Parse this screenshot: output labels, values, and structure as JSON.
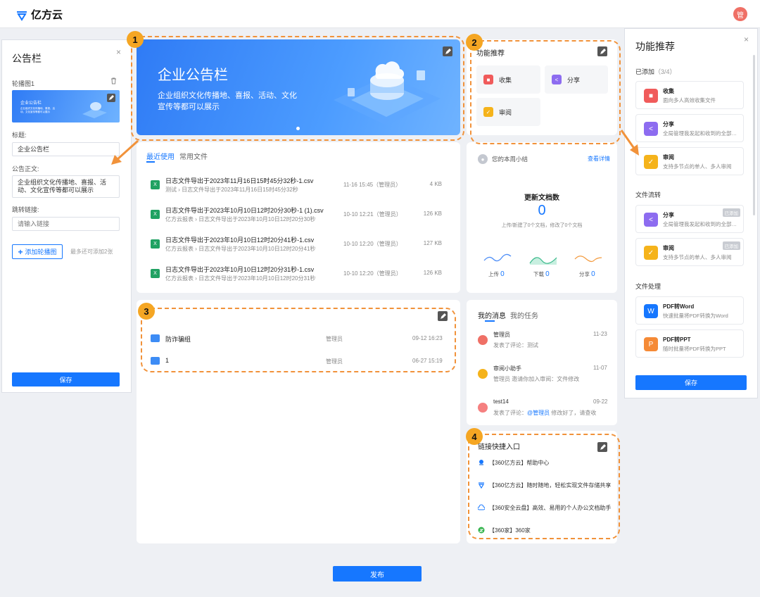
{
  "header": {
    "logo_text": "亿方云",
    "avatar_initial": "管"
  },
  "left_panel": {
    "title": "公告栏",
    "carousel_label": "轮播图1",
    "thumb_title": "企业公告栏",
    "thumb_desc": "企业组织文化传播地、喜报、活动、文化宣传等都可以展示",
    "title_label": "标题:",
    "title_value": "企业公告栏",
    "body_label": "公告正文:",
    "body_value": "企业组织文化传播地、喜报、活动、文化宣传等都可以展示",
    "link_label": "跳转链接:",
    "link_placeholder": "请输入链接",
    "add_button": "添加轮播图",
    "hint": "最多还可添加2张",
    "save": "保存"
  },
  "banner": {
    "title": "企业公告栏",
    "desc": "企业组织文化传播地、喜报、活动、文化宣传等都可以展示"
  },
  "badges": [
    "1",
    "2",
    "3",
    "4"
  ],
  "recent": {
    "tabs": [
      "最近使用",
      "常用文件"
    ],
    "files": [
      {
        "name": "日志文件导出于2023年11月16日15时45分32秒-1.csv",
        "owner": "测试",
        "path": "日志文件导出于2023年11月16日15时45分32秒",
        "time": "11-16 15:45（管理员）",
        "size": "4 KB"
      },
      {
        "name": "日志文件导出于2023年10月10日12时20分30秒-1 (1).csv",
        "owner": "亿方云报表",
        "path": "日志文件导出于2023年10月10日12时20分30秒",
        "time": "10-10 12:21（管理员）",
        "size": "126 KB"
      },
      {
        "name": "日志文件导出于2023年10月10日12时20分41秒-1.csv",
        "owner": "亿方云报表",
        "path": "日志文件导出于2023年10月10日12时20分41秒",
        "time": "10-10 12:20（管理员）",
        "size": "127 KB"
      },
      {
        "name": "日志文件导出于2023年10月10日12时20分31秒-1.csv",
        "owner": "亿方云报表",
        "path": "日志文件导出于2023年10月10日12时20分31秒",
        "time": "10-10 12:20（管理员）",
        "size": "126 KB"
      }
    ]
  },
  "folders": [
    {
      "name": "防诈骗组",
      "owner": "管理员",
      "time": "09-12 16:23"
    },
    {
      "name": "1",
      "owner": "管理员",
      "time": "06-27 15:19"
    }
  ],
  "func_card": {
    "title": "功能推荐",
    "items": [
      "收集",
      "分享",
      "审阅"
    ],
    "colors": [
      "#f05b5b",
      "#8d6cf0",
      "#f5b31b"
    ]
  },
  "weekly": {
    "title": "您的本周小结",
    "link": "查看详情",
    "stat_title": "更新文档数",
    "stat_value": "0",
    "stat_desc": "上传/新建了0个文档，修改了0个文档",
    "metrics": [
      {
        "label": "上传",
        "value": "0"
      },
      {
        "label": "下载",
        "value": "0"
      },
      {
        "label": "分享",
        "value": "0"
      }
    ]
  },
  "messages": {
    "tabs": [
      "我的消息",
      "我的任务"
    ],
    "items": [
      {
        "name": "管理员",
        "date": "11-23",
        "text": "发表了评论：测试",
        "mention": "",
        "tail": "",
        "color": "#ef7066"
      },
      {
        "name": "审阅小助手",
        "date": "11-07",
        "text": "管理员 邀请你加入审阅：文件修改",
        "mention": "",
        "tail": "",
        "color": "#f5b31b"
      },
      {
        "name": "test14",
        "date": "09-22",
        "text": "发表了评论：",
        "mention": "@管理员",
        "tail": " 修改好了，请查收",
        "color": "#f58080"
      }
    ]
  },
  "links": {
    "title": "链接快捷入口",
    "items": [
      "【360亿方云】帮助中心",
      "【360亿方云】随时随地，轻松实现文件存储共享",
      "【360安全云盘】高效、易用的个人办公文档助手",
      "【360家】360家"
    ]
  },
  "right_panel": {
    "title": "功能推荐",
    "added_label": "已添加",
    "added_count": "（3/4）",
    "added": [
      {
        "name": "收集",
        "desc": "面向多人高效收集文件",
        "color": "#f05b5b"
      },
      {
        "name": "分享",
        "desc": "全局管理我发起和收到的全部分享",
        "color": "#8d6cf0"
      },
      {
        "name": "审阅",
        "desc": "支持多节点的单人、多人审阅",
        "color": "#f5b31b"
      }
    ],
    "section2": "文件流转",
    "flow": [
      {
        "name": "分享",
        "desc": "全局管理我发起和收到的全部分享",
        "color": "#8d6cf0",
        "tag": "已添加"
      },
      {
        "name": "审阅",
        "desc": "支持多节点的单人、多人审阅",
        "color": "#f5b31b",
        "tag": "已添加"
      }
    ],
    "section3": "文件处理",
    "process": [
      {
        "name": "PDF转Word",
        "desc": "快速批量将PDF转换为Word",
        "color": "#1677ff"
      },
      {
        "name": "PDF转PPT",
        "desc": "随时批量将PDF转换为PPT",
        "color": "#f58a36"
      }
    ],
    "save": "保存"
  },
  "publish": "发布",
  "colors": {
    "primary": "#1677ff",
    "dash": "#f1923a",
    "badge": "#f5a623"
  }
}
